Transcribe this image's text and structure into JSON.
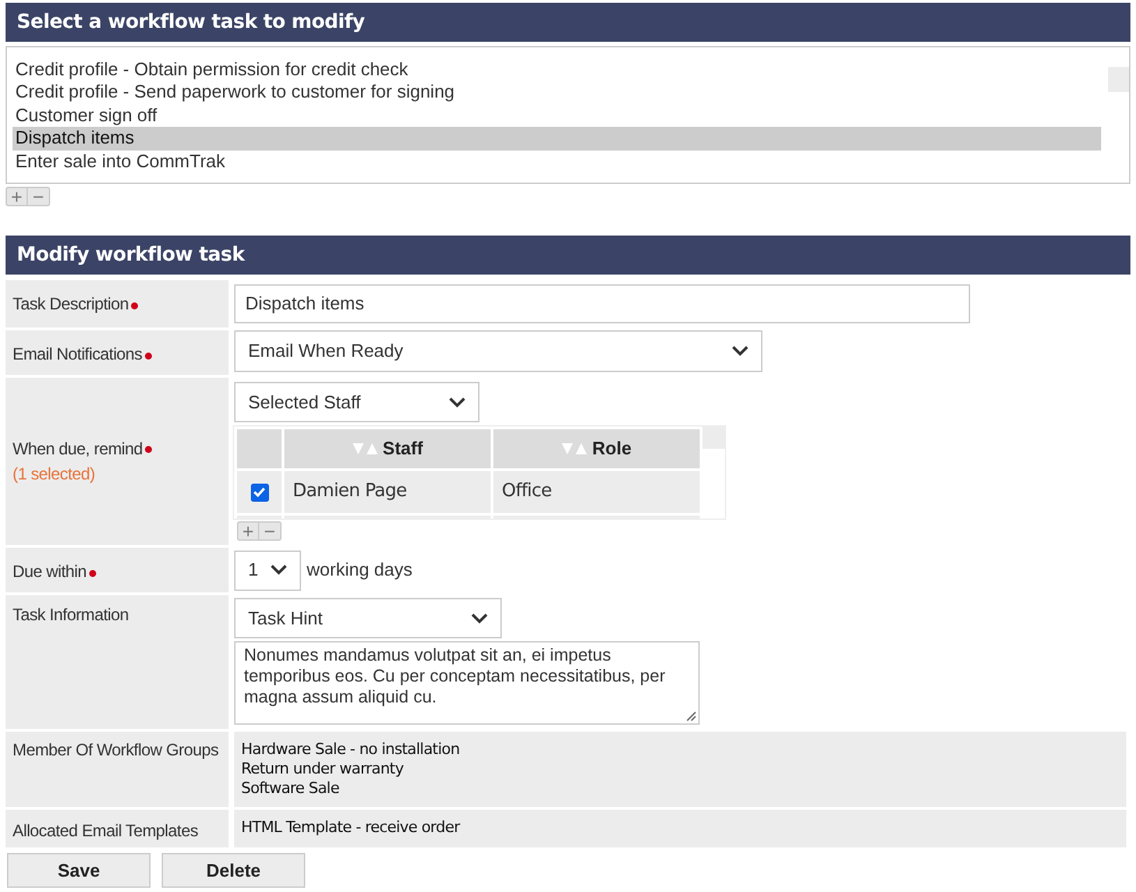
{
  "task_list": {
    "title": "Select a workflow task to modify",
    "items": [
      {
        "label": "Credit profile - Obtain permission for credit check",
        "selected": false
      },
      {
        "label": "Credit profile - Send paperwork to customer for signing",
        "selected": false
      },
      {
        "label": "Customer sign off",
        "selected": false
      },
      {
        "label": "Dispatch items",
        "selected": true
      },
      {
        "label": "Enter sale into CommTrak",
        "selected": false
      }
    ],
    "add_button": "+",
    "remove_button": "−"
  },
  "form": {
    "title": "Modify workflow task",
    "task_description": {
      "label": "Task Description",
      "required": true,
      "value": "Dispatch items"
    },
    "email_notifications": {
      "label": "Email Notifications",
      "required": true,
      "value": "Email When Ready"
    },
    "remind": {
      "label": "When due, remind",
      "required": true,
      "note": "(1 selected)",
      "value": "Selected Staff",
      "columns": [
        "Staff",
        "Role"
      ],
      "rows": [
        {
          "staff": "Damien Page",
          "role": "Office",
          "checked": true
        }
      ],
      "add_button": "+",
      "remove_button": "−"
    },
    "due_within": {
      "label": "Due within",
      "required": true,
      "value": "1",
      "unit": "working days"
    },
    "task_information": {
      "label": "Task Information",
      "value": "Task Hint",
      "text": "Nonumes mandamus volutpat sit an, ei impetus temporibus eos. Cu per conceptam necessitatibus, per magna assum aliquid cu."
    },
    "groups": {
      "label": "Member Of Workflow Groups",
      "items": [
        "Hardware Sale - no installation",
        "Return under warranty",
        "Software Sale"
      ]
    },
    "templates": {
      "label": "Allocated Email Templates",
      "items": [
        "HTML Template - receive order"
      ]
    }
  },
  "buttons": [
    "Save",
    "Delete"
  ]
}
